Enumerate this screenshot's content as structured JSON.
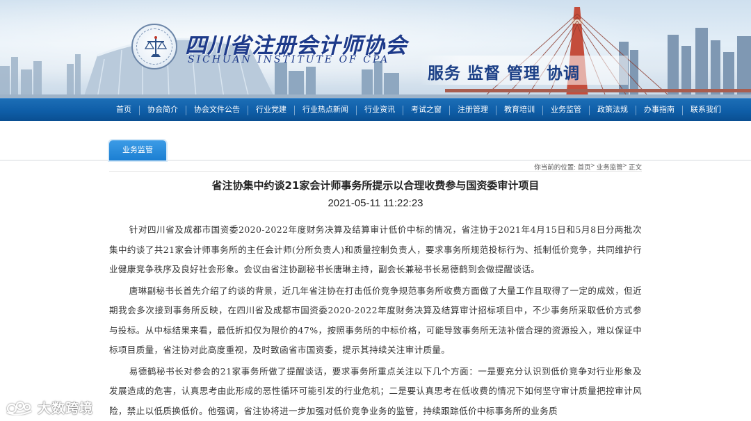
{
  "header": {
    "org_name": "四川省注册会计师协会",
    "org_name_en": "SICHUAN INSTITUTE OF CPA",
    "slogan": "服务 监督 管理 协调"
  },
  "nav": {
    "items": [
      {
        "label": "首页"
      },
      {
        "label": "协会简介"
      },
      {
        "label": "协会文件公告"
      },
      {
        "label": "行业党建"
      },
      {
        "label": "行业热点新闻"
      },
      {
        "label": "行业资讯"
      },
      {
        "label": "考试之窗"
      },
      {
        "label": "注册管理"
      },
      {
        "label": "教育培训"
      },
      {
        "label": "业务监管"
      },
      {
        "label": "政策法规"
      },
      {
        "label": "办事指南"
      },
      {
        "label": "联系我们"
      }
    ]
  },
  "section_tab": "业务监管",
  "breadcrumb": {
    "prefix": "你当前的位置: ",
    "home": "首页",
    "sep1": "> ",
    "section": "业务监管",
    "sep2": "> ",
    "current": "正文"
  },
  "article": {
    "title": "省注协集中约谈21家会计师事务所提示以合理收费参与国资委审计项目",
    "date": "2021-05-11 11:22:23",
    "paragraphs": [
      "针对四川省及成都市国资委2020-2022年度财务决算及结算审计低价中标的情况，省注协于2021年4月15日和5月8日分两批次集中约谈了共21家会计师事务所的主任会计师(分所负责人)和质量控制负责人，要求事务所规范投标行为、抵制低价竞争，共同维护行业健康竞争秩序及良好社会形象。会议由省注协副秘书长唐琳主持，副会长兼秘书长易德鹤到会做提醒谈话。",
      "唐琳副秘书长首先介绍了约谈的背景，近几年省注协在打击低价竞争规范事务所收费方面做了大量工作且取得了一定的成效，但近期我会多次接到事务所反映，在四川省及成都市国资委2020-2022年度财务决算及结算审计招标项目中，不少事务所采取低价方式参与投标。从中标结果来看，最低折扣仅为限价的47%，按照事务所的中标价格，可能导致事务所无法补偿合理的资源投入，难以保证中标项目质量，省注协对此高度重视，及时致函省市国资委，提示其持续关注审计质量。",
      "易德鹤秘书长对参会的21家事务所做了提醒谈话，要求事务所重点关注以下几个方面：一是要充分认识到低价竞争对行业形象及发展造成的危害，认真思考由此形成的恶性循环可能引发的行业危机；二是要认真思考在低收费的情况下如何坚守审计质量把控审计风险，禁止以低质换低价。他强调，省注协将进一步加强对低价竞争业务的监管，持续跟踪低价中标事务所的业务质"
    ]
  },
  "watermark": {
    "text": "大数跨境"
  },
  "colors": {
    "nav_bg": "#0f5ea8",
    "tab_bg": "#1b7fd2",
    "brand_text": "#1d3a8a"
  }
}
